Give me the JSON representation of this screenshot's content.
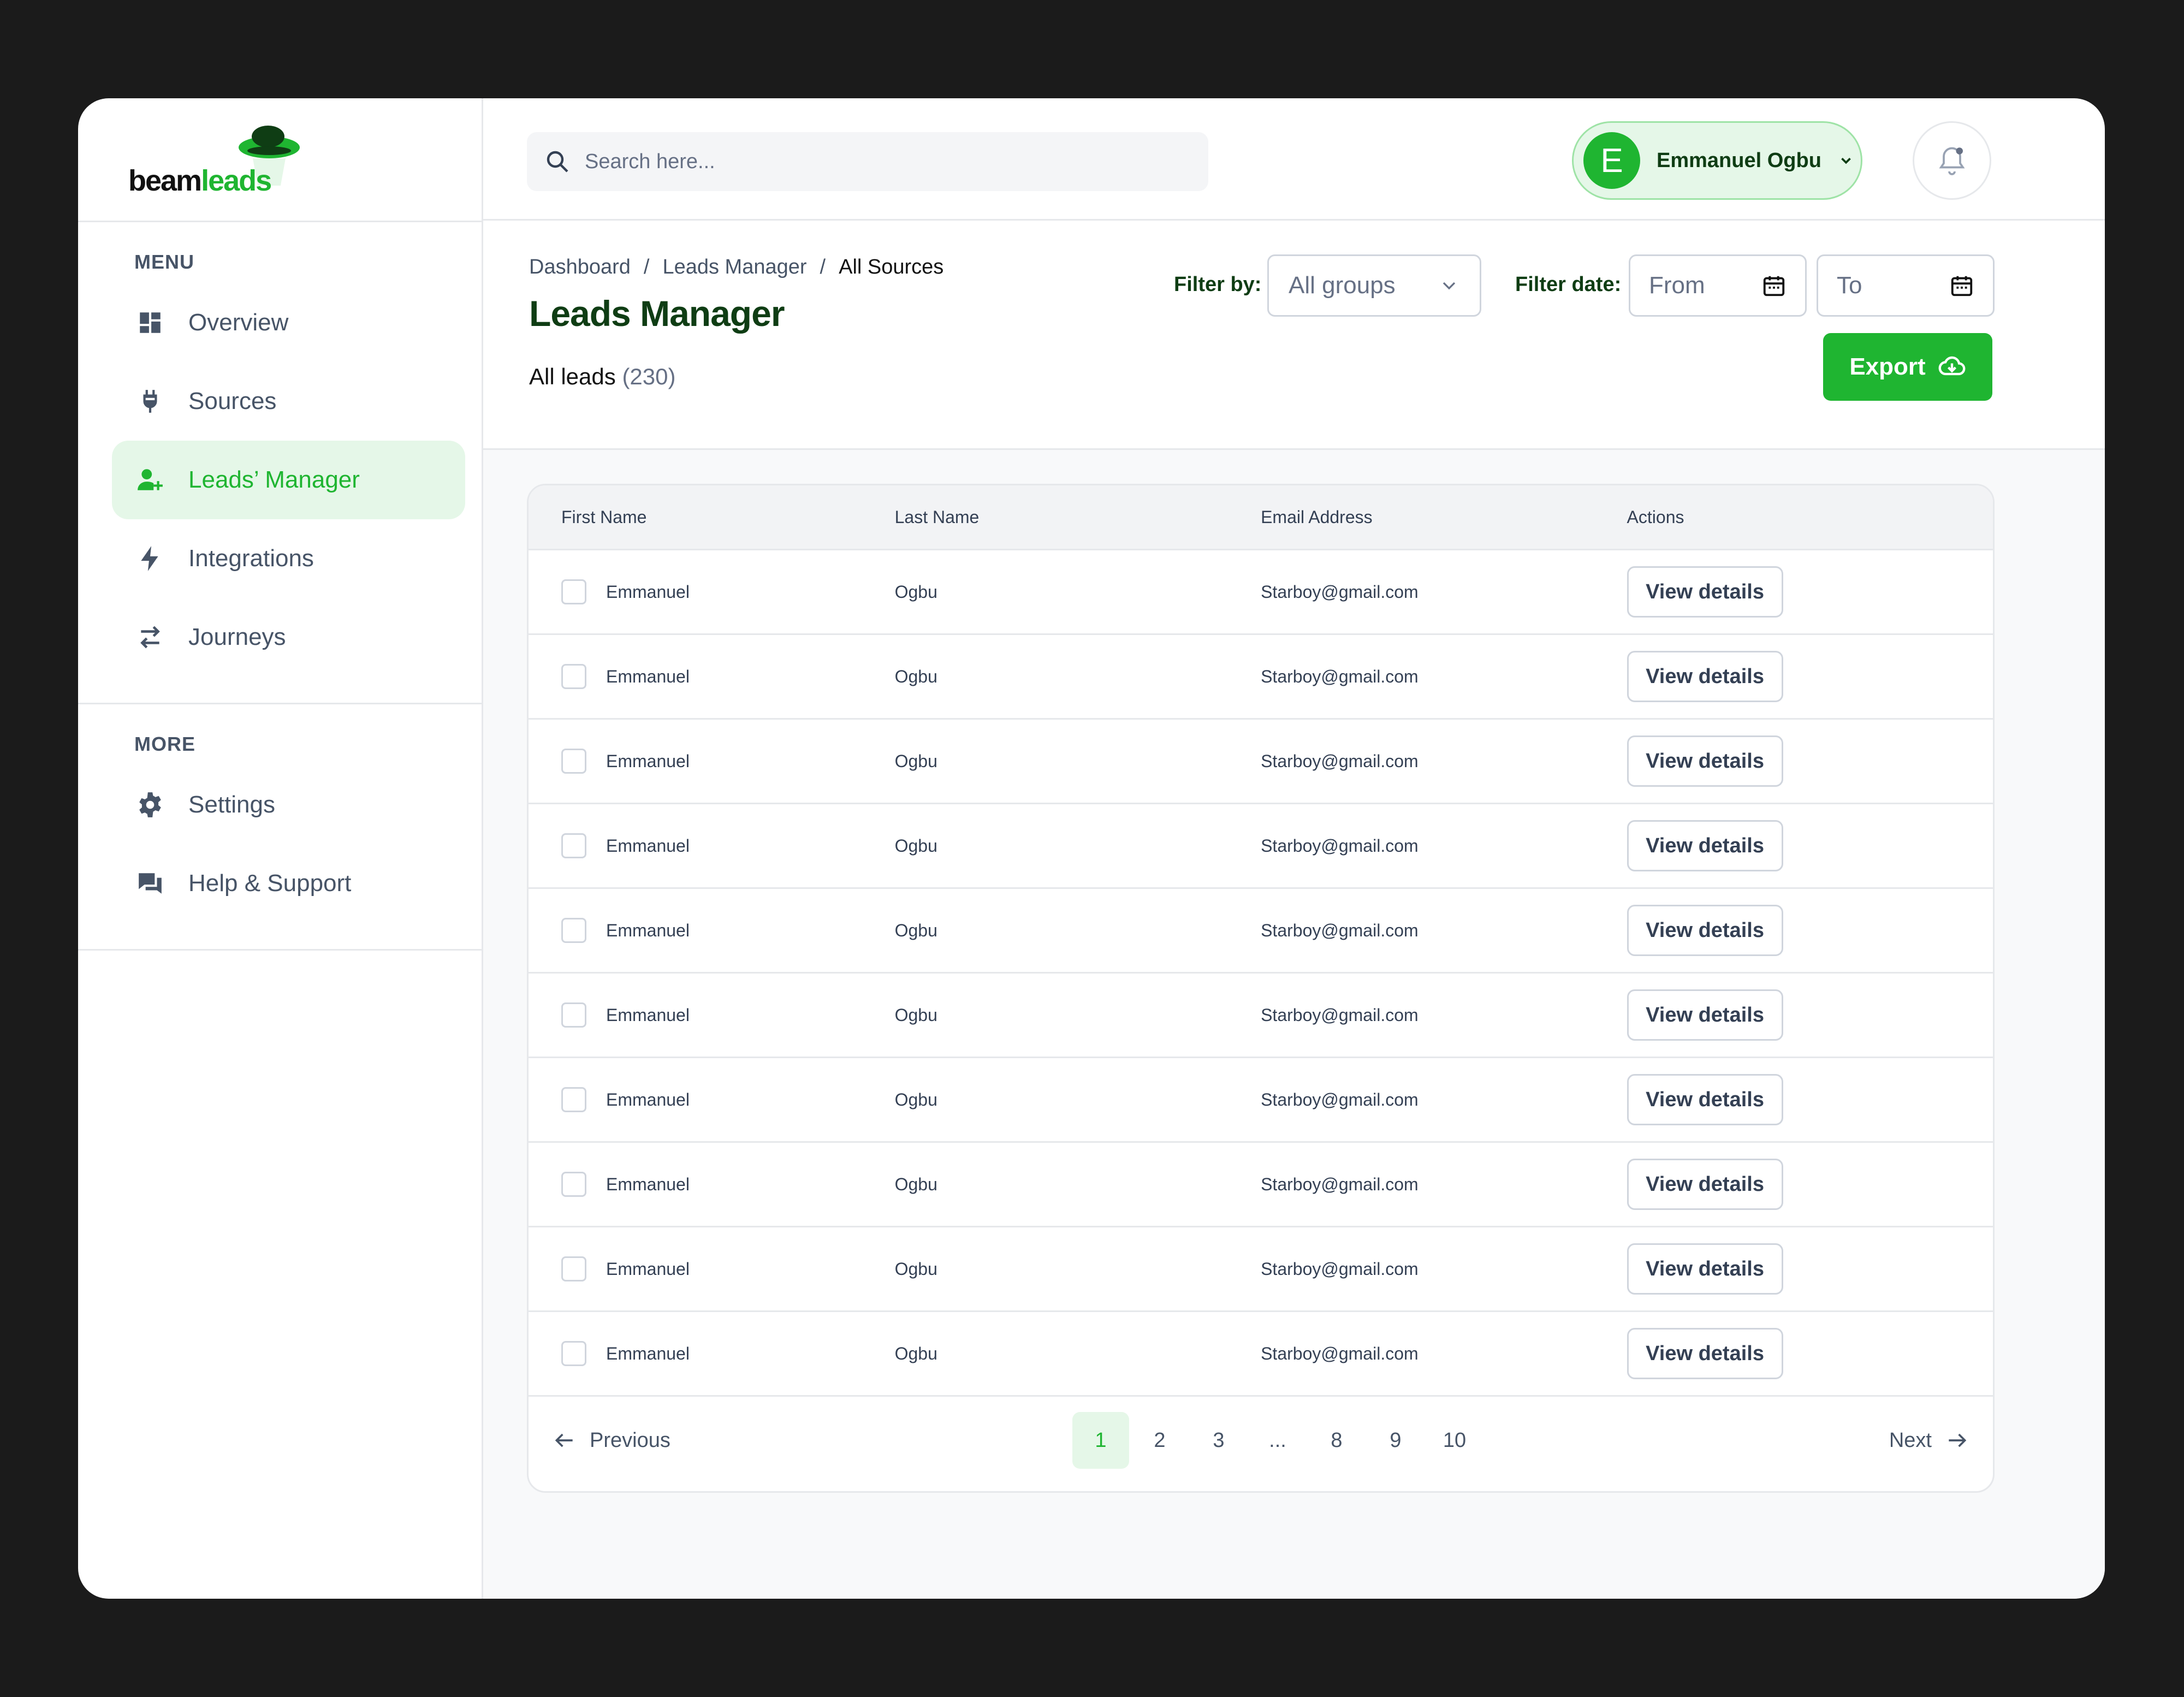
{
  "brand": {
    "logo_primary": "beam",
    "logo_accent": "leads",
    "accent_color": "#1fb531",
    "dark_color": "#0f3d14"
  },
  "sidebar": {
    "menu_label": "MENU",
    "menu_items": [
      {
        "label": "Overview",
        "icon": "dashboard-icon"
      },
      {
        "label": "Sources",
        "icon": "plug-icon"
      },
      {
        "label": "Leads’ Manager",
        "icon": "user-add-icon",
        "active": true
      },
      {
        "label": "Integrations",
        "icon": "bolt-icon"
      },
      {
        "label": "Journeys",
        "icon": "swap-icon"
      }
    ],
    "more_label": "MORE",
    "more_items": [
      {
        "label": "Settings",
        "icon": "gear-icon"
      },
      {
        "label": "Help & Support",
        "icon": "chat-icon"
      }
    ]
  },
  "topbar": {
    "search_placeholder": "Search here...",
    "user": {
      "initial": "E",
      "name": "Emmanuel Ogbu"
    }
  },
  "header": {
    "breadcrumb": [
      "Dashboard",
      "Leads Manager",
      "All Sources"
    ],
    "title": "Leads Manager",
    "all_leads_label": "All leads",
    "all_leads_count": "(230)",
    "filter_by_label": "Filter by:",
    "filter_group_value": "All groups",
    "filter_date_label": "Filter date:",
    "date_from_placeholder": "From",
    "date_to_placeholder": "To",
    "export_label": "Export"
  },
  "table": {
    "columns": [
      "First Name",
      "Last Name",
      "Email Address",
      "Actions"
    ],
    "rows": [
      {
        "first": "Emmanuel",
        "last": "Ogbu",
        "email": "Starboy@gmail.com",
        "action": "View details"
      },
      {
        "first": "Emmanuel",
        "last": "Ogbu",
        "email": "Starboy@gmail.com",
        "action": "View details"
      },
      {
        "first": "Emmanuel",
        "last": "Ogbu",
        "email": "Starboy@gmail.com",
        "action": "View details"
      },
      {
        "first": "Emmanuel",
        "last": "Ogbu",
        "email": "Starboy@gmail.com",
        "action": "View details"
      },
      {
        "first": "Emmanuel",
        "last": "Ogbu",
        "email": "Starboy@gmail.com",
        "action": "View details"
      },
      {
        "first": "Emmanuel",
        "last": "Ogbu",
        "email": "Starboy@gmail.com",
        "action": "View details"
      },
      {
        "first": "Emmanuel",
        "last": "Ogbu",
        "email": "Starboy@gmail.com",
        "action": "View details"
      },
      {
        "first": "Emmanuel",
        "last": "Ogbu",
        "email": "Starboy@gmail.com",
        "action": "View details"
      },
      {
        "first": "Emmanuel",
        "last": "Ogbu",
        "email": "Starboy@gmail.com",
        "action": "View details"
      },
      {
        "first": "Emmanuel",
        "last": "Ogbu",
        "email": "Starboy@gmail.com",
        "action": "View details"
      }
    ]
  },
  "pagination": {
    "previous_label": "Previous",
    "next_label": "Next",
    "pages": [
      "1",
      "2",
      "3",
      "...",
      "8",
      "9",
      "10"
    ],
    "current": "1"
  }
}
